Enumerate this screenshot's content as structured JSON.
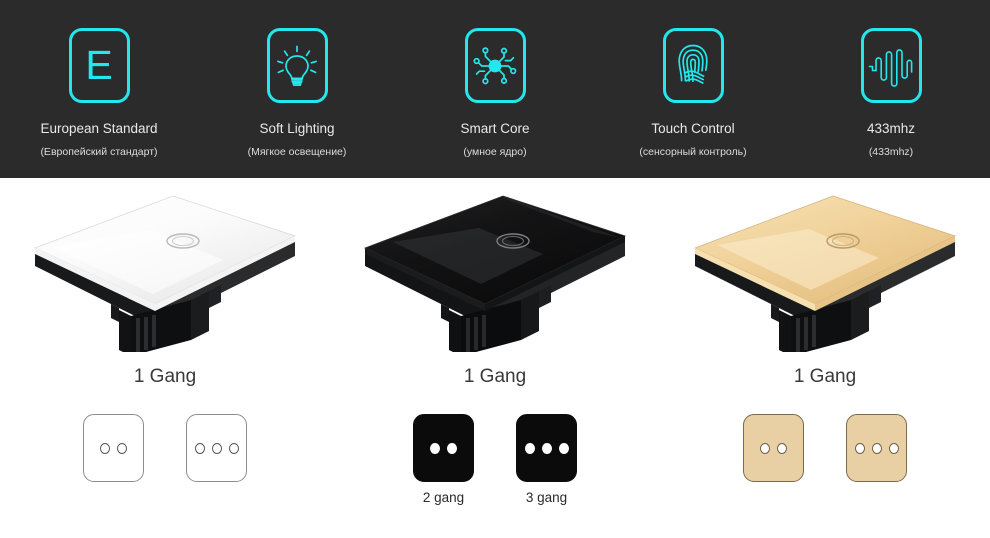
{
  "theme": {
    "header_bg": "#2b2b2b",
    "accent_cyan": "#22e8ed",
    "body_bg": "#ffffff",
    "gold": "#e8cfa4",
    "black_panel": "#0b0b0b"
  },
  "features": [
    {
      "icon": "european-standard-e-icon",
      "glyph": "E",
      "label": "European Standard",
      "sublabel": "(Европейский стандарт)"
    },
    {
      "icon": "light-bulb-icon",
      "glyph": "",
      "label": "Soft Lighting",
      "sublabel": "(Мягкое освещение)"
    },
    {
      "icon": "smart-core-circuit-icon",
      "glyph": "",
      "label": "Smart Core",
      "sublabel": "(умное ядро)"
    },
    {
      "icon": "fingerprint-icon",
      "glyph": "",
      "label": "Touch Control",
      "sublabel": "(сенсорный контроль)"
    },
    {
      "icon": "radio-waveform-icon",
      "glyph": "",
      "label": "433mhz",
      "sublabel": "(433mhz)"
    }
  ],
  "products": [
    {
      "color_name": "white",
      "panel_color": "#ffffff",
      "gang_title": "1 Gang",
      "variants": [
        {
          "dots": 2,
          "caption": ""
        },
        {
          "dots": 3,
          "caption": ""
        }
      ]
    },
    {
      "color_name": "black",
      "panel_color": "#0b0b0b",
      "gang_title": "1 Gang",
      "variants": [
        {
          "dots": 2,
          "caption": "2 gang"
        },
        {
          "dots": 3,
          "caption": "3 gang"
        }
      ]
    },
    {
      "color_name": "gold",
      "panel_color": "#e8cfa4",
      "gang_title": "1 Gang",
      "variants": [
        {
          "dots": 2,
          "caption": ""
        },
        {
          "dots": 3,
          "caption": ""
        }
      ]
    }
  ]
}
